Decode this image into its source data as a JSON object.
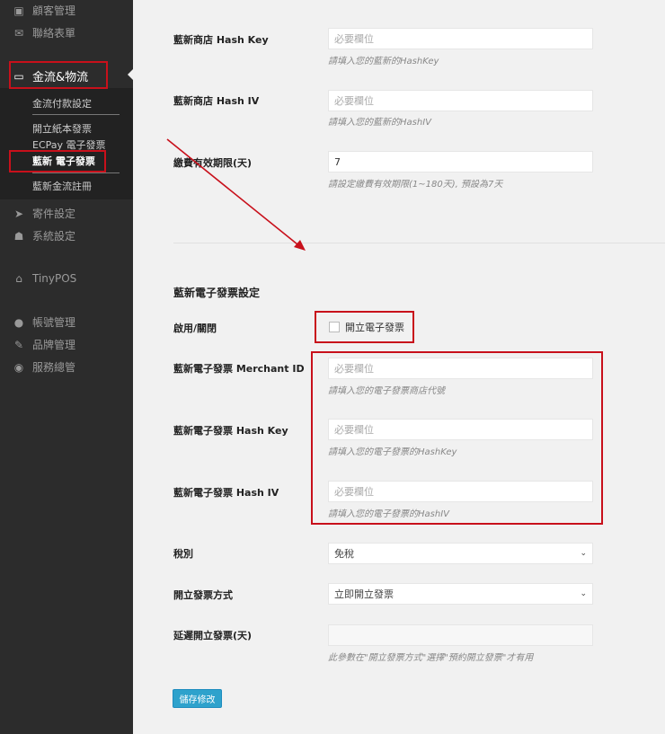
{
  "sidebar": {
    "items": [
      {
        "label": "顧客管理",
        "icon": "id-card-icon"
      },
      {
        "label": "聯絡表單",
        "icon": "envelope-icon"
      },
      {
        "label": "金流&物流",
        "icon": "credit-card-icon"
      },
      {
        "label": "寄件設定",
        "icon": "paper-plane-icon"
      },
      {
        "label": "系統設定",
        "icon": "sitemap-icon"
      },
      {
        "label": "TinyPOS",
        "icon": "store-icon"
      },
      {
        "label": "帳號管理",
        "icon": "user-icon"
      },
      {
        "label": "品牌管理",
        "icon": "gavel-icon"
      },
      {
        "label": "服務總管",
        "icon": "dashboard-icon"
      }
    ],
    "submenu": [
      "金流付款設定",
      "開立紙本發票",
      "ECPay 電子發票",
      "藍新 電子發票",
      "藍新金流註冊"
    ]
  },
  "form": {
    "hash_key": {
      "label": "藍新商店 Hash Key",
      "placeholder": "必要欄位",
      "desc": "請填入您的藍新的HashKey"
    },
    "hash_iv": {
      "label": "藍新商店 Hash IV",
      "placeholder": "必要欄位",
      "desc": "請填入您的藍新的HashIV"
    },
    "expire": {
      "label": "繳費有效期限(天)",
      "value": "7",
      "desc": "請設定繳費有效期限(1~180天), 預設為7天"
    },
    "section_title": "藍新電子發票設定",
    "enable": {
      "label": "啟用/關閉",
      "checkbox_label": "開立電子發票",
      "checked": false
    },
    "inv_merchant": {
      "label": "藍新電子發票 Merchant ID",
      "placeholder": "必要欄位",
      "desc": "請填入您的電子發票商店代號"
    },
    "inv_key": {
      "label": "藍新電子發票 Hash Key",
      "placeholder": "必要欄位",
      "desc": "請填入您的電子發票的HashKey"
    },
    "inv_iv": {
      "label": "藍新電子發票 Hash IV",
      "placeholder": "必要欄位",
      "desc": "請填入您的電子發票的HashIV"
    },
    "tax": {
      "label": "稅別",
      "value": "免稅"
    },
    "method": {
      "label": "開立發票方式",
      "value": "立即開立發票"
    },
    "delay": {
      "label": "延遲開立發票(天)",
      "value": "",
      "desc": "此參數在\"開立發票方式\"選擇\"預約開立發票\"才有用"
    },
    "save_label": "儲存修改"
  },
  "colors": {
    "annotation": "#c8101b",
    "button": "#2ea2cc"
  }
}
